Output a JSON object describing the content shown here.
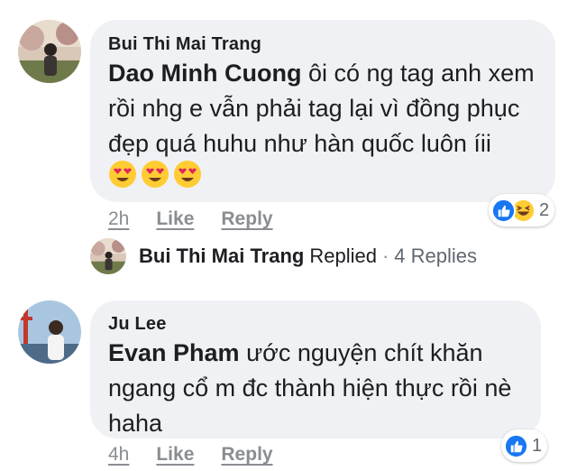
{
  "comments": [
    {
      "author": "Bui Thi Mai Trang",
      "mention": "Dao Minh Cuong",
      "lines": [
        "ôi có ng tag anh xem",
        "rồi nhg e vẫn phải tag lại vì đồng phục",
        "đẹp quá huhu như hàn quốc luôn íii"
      ],
      "emojis": [
        "heart-eyes-emoji",
        "heart-eyes-emoji",
        "heart-eyes-emoji"
      ],
      "time": "2h",
      "like_label": "Like",
      "reply_label": "Reply",
      "reaction_icons": [
        "like-icon",
        "haha-icon"
      ],
      "reaction_count": "2"
    },
    {
      "author": "Ju Lee",
      "mention": "Evan Pham",
      "lines": [
        "ước nguyện chít khăn",
        "ngang cổ m đc thành hiện thực rồi nè",
        "haha"
      ],
      "time": "4h",
      "like_label": "Like",
      "reply_label": "Reply",
      "reaction_icons": [
        "like-icon"
      ],
      "reaction_count": "1"
    }
  ],
  "reply_summary": {
    "name": "Bui Thi Mai Trang",
    "action": "Replied",
    "separator": "·",
    "count": "4 Replies"
  },
  "colors": {
    "bubble": "#f0f1f4",
    "like_blue": "#1877f2",
    "meta_gray": "#8a8d91",
    "emoji_yellow": "#ffcc33"
  }
}
